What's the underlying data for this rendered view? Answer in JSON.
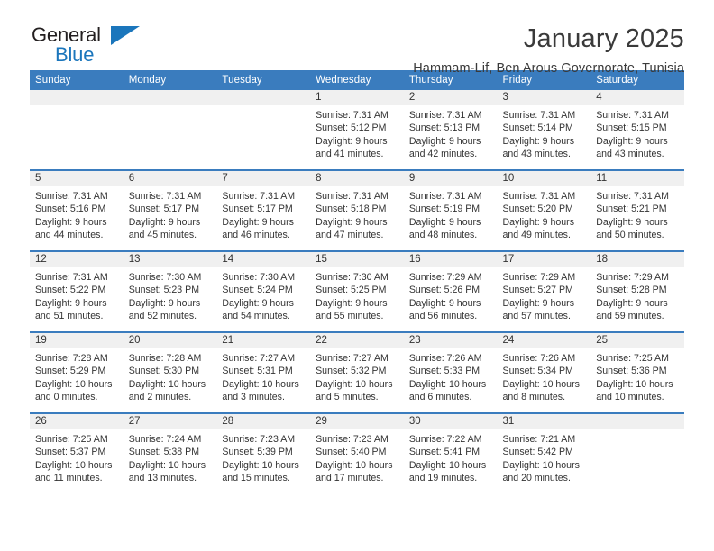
{
  "brand": {
    "name_part1": "General",
    "name_part2": "Blue",
    "logo_icon": "triangle-flag-icon"
  },
  "header": {
    "title": "January 2025",
    "subtitle": "Hammam-Lif, Ben Arous Governorate, Tunisia"
  },
  "colors": {
    "header_blue": "#3a7cbe",
    "brand_blue": "#1b76bc",
    "daynum_band": "#f0f0f0",
    "text": "#333333"
  },
  "weekday_headers": [
    "Sunday",
    "Monday",
    "Tuesday",
    "Wednesday",
    "Thursday",
    "Friday",
    "Saturday"
  ],
  "weeks": [
    [
      {
        "day": "",
        "sunrise": "",
        "sunset": "",
        "daylight1": "",
        "daylight2": "",
        "empty": true
      },
      {
        "day": "",
        "sunrise": "",
        "sunset": "",
        "daylight1": "",
        "daylight2": "",
        "empty": true
      },
      {
        "day": "",
        "sunrise": "",
        "sunset": "",
        "daylight1": "",
        "daylight2": "",
        "empty": true
      },
      {
        "day": "1",
        "sunrise": "Sunrise: 7:31 AM",
        "sunset": "Sunset: 5:12 PM",
        "daylight1": "Daylight: 9 hours",
        "daylight2": "and 41 minutes."
      },
      {
        "day": "2",
        "sunrise": "Sunrise: 7:31 AM",
        "sunset": "Sunset: 5:13 PM",
        "daylight1": "Daylight: 9 hours",
        "daylight2": "and 42 minutes."
      },
      {
        "day": "3",
        "sunrise": "Sunrise: 7:31 AM",
        "sunset": "Sunset: 5:14 PM",
        "daylight1": "Daylight: 9 hours",
        "daylight2": "and 43 minutes."
      },
      {
        "day": "4",
        "sunrise": "Sunrise: 7:31 AM",
        "sunset": "Sunset: 5:15 PM",
        "daylight1": "Daylight: 9 hours",
        "daylight2": "and 43 minutes."
      }
    ],
    [
      {
        "day": "5",
        "sunrise": "Sunrise: 7:31 AM",
        "sunset": "Sunset: 5:16 PM",
        "daylight1": "Daylight: 9 hours",
        "daylight2": "and 44 minutes."
      },
      {
        "day": "6",
        "sunrise": "Sunrise: 7:31 AM",
        "sunset": "Sunset: 5:17 PM",
        "daylight1": "Daylight: 9 hours",
        "daylight2": "and 45 minutes."
      },
      {
        "day": "7",
        "sunrise": "Sunrise: 7:31 AM",
        "sunset": "Sunset: 5:17 PM",
        "daylight1": "Daylight: 9 hours",
        "daylight2": "and 46 minutes."
      },
      {
        "day": "8",
        "sunrise": "Sunrise: 7:31 AM",
        "sunset": "Sunset: 5:18 PM",
        "daylight1": "Daylight: 9 hours",
        "daylight2": "and 47 minutes."
      },
      {
        "day": "9",
        "sunrise": "Sunrise: 7:31 AM",
        "sunset": "Sunset: 5:19 PM",
        "daylight1": "Daylight: 9 hours",
        "daylight2": "and 48 minutes."
      },
      {
        "day": "10",
        "sunrise": "Sunrise: 7:31 AM",
        "sunset": "Sunset: 5:20 PM",
        "daylight1": "Daylight: 9 hours",
        "daylight2": "and 49 minutes."
      },
      {
        "day": "11",
        "sunrise": "Sunrise: 7:31 AM",
        "sunset": "Sunset: 5:21 PM",
        "daylight1": "Daylight: 9 hours",
        "daylight2": "and 50 minutes."
      }
    ],
    [
      {
        "day": "12",
        "sunrise": "Sunrise: 7:31 AM",
        "sunset": "Sunset: 5:22 PM",
        "daylight1": "Daylight: 9 hours",
        "daylight2": "and 51 minutes."
      },
      {
        "day": "13",
        "sunrise": "Sunrise: 7:30 AM",
        "sunset": "Sunset: 5:23 PM",
        "daylight1": "Daylight: 9 hours",
        "daylight2": "and 52 minutes."
      },
      {
        "day": "14",
        "sunrise": "Sunrise: 7:30 AM",
        "sunset": "Sunset: 5:24 PM",
        "daylight1": "Daylight: 9 hours",
        "daylight2": "and 54 minutes."
      },
      {
        "day": "15",
        "sunrise": "Sunrise: 7:30 AM",
        "sunset": "Sunset: 5:25 PM",
        "daylight1": "Daylight: 9 hours",
        "daylight2": "and 55 minutes."
      },
      {
        "day": "16",
        "sunrise": "Sunrise: 7:29 AM",
        "sunset": "Sunset: 5:26 PM",
        "daylight1": "Daylight: 9 hours",
        "daylight2": "and 56 minutes."
      },
      {
        "day": "17",
        "sunrise": "Sunrise: 7:29 AM",
        "sunset": "Sunset: 5:27 PM",
        "daylight1": "Daylight: 9 hours",
        "daylight2": "and 57 minutes."
      },
      {
        "day": "18",
        "sunrise": "Sunrise: 7:29 AM",
        "sunset": "Sunset: 5:28 PM",
        "daylight1": "Daylight: 9 hours",
        "daylight2": "and 59 minutes."
      }
    ],
    [
      {
        "day": "19",
        "sunrise": "Sunrise: 7:28 AM",
        "sunset": "Sunset: 5:29 PM",
        "daylight1": "Daylight: 10 hours",
        "daylight2": "and 0 minutes."
      },
      {
        "day": "20",
        "sunrise": "Sunrise: 7:28 AM",
        "sunset": "Sunset: 5:30 PM",
        "daylight1": "Daylight: 10 hours",
        "daylight2": "and 2 minutes."
      },
      {
        "day": "21",
        "sunrise": "Sunrise: 7:27 AM",
        "sunset": "Sunset: 5:31 PM",
        "daylight1": "Daylight: 10 hours",
        "daylight2": "and 3 minutes."
      },
      {
        "day": "22",
        "sunrise": "Sunrise: 7:27 AM",
        "sunset": "Sunset: 5:32 PM",
        "daylight1": "Daylight: 10 hours",
        "daylight2": "and 5 minutes."
      },
      {
        "day": "23",
        "sunrise": "Sunrise: 7:26 AM",
        "sunset": "Sunset: 5:33 PM",
        "daylight1": "Daylight: 10 hours",
        "daylight2": "and 6 minutes."
      },
      {
        "day": "24",
        "sunrise": "Sunrise: 7:26 AM",
        "sunset": "Sunset: 5:34 PM",
        "daylight1": "Daylight: 10 hours",
        "daylight2": "and 8 minutes."
      },
      {
        "day": "25",
        "sunrise": "Sunrise: 7:25 AM",
        "sunset": "Sunset: 5:36 PM",
        "daylight1": "Daylight: 10 hours",
        "daylight2": "and 10 minutes."
      }
    ],
    [
      {
        "day": "26",
        "sunrise": "Sunrise: 7:25 AM",
        "sunset": "Sunset: 5:37 PM",
        "daylight1": "Daylight: 10 hours",
        "daylight2": "and 11 minutes."
      },
      {
        "day": "27",
        "sunrise": "Sunrise: 7:24 AM",
        "sunset": "Sunset: 5:38 PM",
        "daylight1": "Daylight: 10 hours",
        "daylight2": "and 13 minutes."
      },
      {
        "day": "28",
        "sunrise": "Sunrise: 7:23 AM",
        "sunset": "Sunset: 5:39 PM",
        "daylight1": "Daylight: 10 hours",
        "daylight2": "and 15 minutes."
      },
      {
        "day": "29",
        "sunrise": "Sunrise: 7:23 AM",
        "sunset": "Sunset: 5:40 PM",
        "daylight1": "Daylight: 10 hours",
        "daylight2": "and 17 minutes."
      },
      {
        "day": "30",
        "sunrise": "Sunrise: 7:22 AM",
        "sunset": "Sunset: 5:41 PM",
        "daylight1": "Daylight: 10 hours",
        "daylight2": "and 19 minutes."
      },
      {
        "day": "31",
        "sunrise": "Sunrise: 7:21 AM",
        "sunset": "Sunset: 5:42 PM",
        "daylight1": "Daylight: 10 hours",
        "daylight2": "and 20 minutes."
      },
      {
        "day": "",
        "sunrise": "",
        "sunset": "",
        "daylight1": "",
        "daylight2": "",
        "empty": true
      }
    ]
  ]
}
